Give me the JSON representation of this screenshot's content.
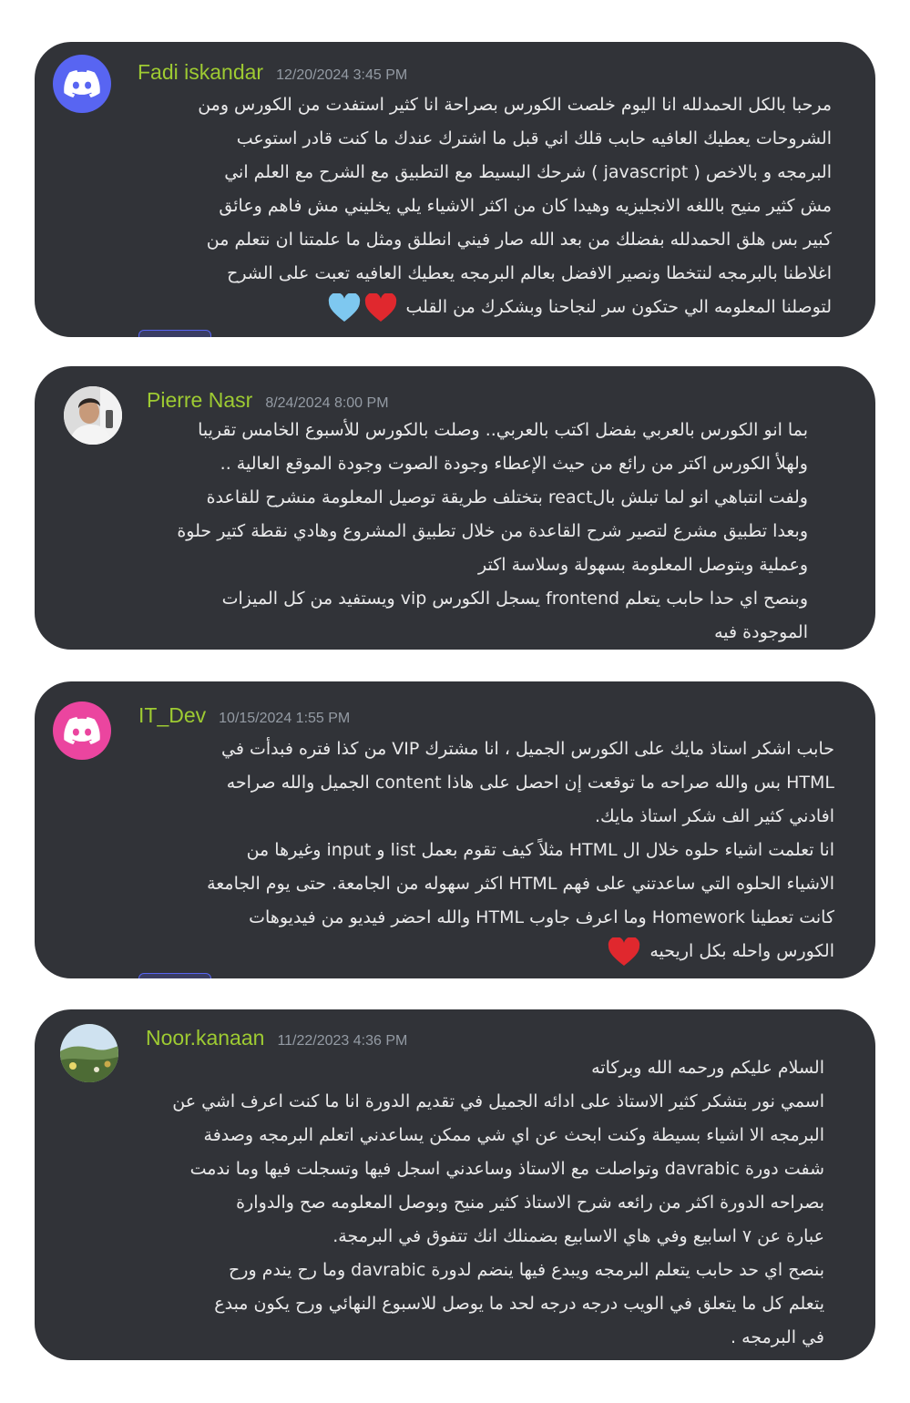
{
  "colors": {
    "card_bg": "#313338",
    "username": "#9ecb32",
    "timestamp": "#949ba4",
    "message_text": "#e9e9ea",
    "discord_blurple": "#5865f2",
    "discord_pink": "#eb459f",
    "heart_red": "#e0282e",
    "heart_blue": "#7ec8f0"
  },
  "messages": [
    {
      "username": "Fadi iskandar",
      "timestamp": "12/20/2024 3:45 PM",
      "avatar_icon": "discord-logo-icon",
      "lines": [
        "مرحبا بالكل الحمدلله انا اليوم خلصت الكورس بصراحة انا كثير استفدت من الكورس ومن",
        "الشروحات يعطيك العافيه حابب قلك اني قبل ما اشترك عندك ما كنت قادر استوعب",
        "البرمجه و بالاخص ( javascript ) شرحك البسيط مع التطبيق مع الشرح مع العلم اني",
        "مش كثير منيح باللغه الانجليزيه وهيدا كان من اكثر الاشياء يلي يخليني مش فاهم وعائق",
        "كبير بس هلق الحمدلله بفضلك من بعد الله صار فيني انطلق ومثل ما علمتنا ان نتعلم من",
        "اغلاطنا بالبرمجه لنتخطا ونصير الافضل بعالم البرمجه يعطيك العافيه تعبت على الشرح",
        "لتوصلنا المعلومه الي حتكون سر لنجاحنا وبشكرك من القلب"
      ],
      "emoji": [
        "red-heart-icon",
        "blue-heart-icon"
      ]
    },
    {
      "username": "Pierre Nasr",
      "timestamp": "8/24/2024 8:00 PM",
      "avatar_icon": "user-photo-avatar",
      "lines": [
        "بما انو الكورس بالعربي بفضل اكتب بالعربي.. وصلت بالكورس للأسبوع الخامس تقريبا",
        "ولهلأ الكورس اكتر من رائع من حيث الإعطاء وجودة الصوت وجودة الموقع العالية ..",
        "ولفت انتباهي انو لما تبلش بالreact بتختلف طريقة توصيل المعلومة منشرح للقاعدة",
        "وبعدا تطبيق مشرع لتصير شرح القاعدة من خلال تطبيق المشروع وهادي نقطة كتير حلوة",
        "وعملية وبتوصل المعلومة بسهولة وسلاسة اكتر",
        "وبنصح اي حدا حابب يتعلم frontend يسجل الكورس vip ويستفيد من كل الميزات",
        "الموجودة فيه"
      ],
      "emoji": []
    },
    {
      "username": "IT_Dev",
      "timestamp": "10/15/2024 1:55 PM",
      "avatar_icon": "discord-logo-icon",
      "lines": [
        "حابب اشكر استاذ مايك على الكورس الجميل ، انا مشترك VIP من كذا فتره فبدأت في",
        "HTML بس والله صراحه ما توقعت إن احصل على هاذا content الجميل والله صراحه",
        "افادني كثير الف شكر استاذ مايك.",
        "انا تعلمت اشياء حلوه خلال ال HTML مثلاً كيف تقوم بعمل list و input وغيرها من",
        "الاشياء الحلوه التي ساعدتني على فهم HTML اكثر سهوله من الجامعة. حتى يوم الجامعة",
        "كانت تعطينا Homework وما اعرف جاوب HTML والله احضر فيديو من فيديوهات",
        "الكورس واحله بكل اريحيه"
      ],
      "emoji": [
        "red-heart-icon"
      ]
    },
    {
      "username": "Noor.kanaan",
      "timestamp": "11/22/2023 4:36 PM",
      "avatar_icon": "landscape-photo-avatar",
      "lines": [
        "السلام عليكم ورحمه الله وبركاته",
        "اسمي نور بتشكر كثير الاستاذ على ادائه الجميل في تقديم الدورة انا ما كنت اعرف اشي عن",
        "البرمجه الا اشياء بسيطة وكنت ابحث عن اي شي ممكن يساعدني اتعلم البرمجه وصدفة",
        "شفت دورة davrabic وتواصلت مع الاستاذ وساعدني اسجل فيها وتسجلت فيها وما ندمت",
        "بصراحه الدورة اكثر من رائعه شرح الاستاذ كثير منيح وبوصل المعلومه صح والدوارة",
        "عبارة عن ٧ اسابيع وفي هاي الاسابيع بضمنلك انك تتفوق في البرمجة.",
        "بنصح اي حد حابب يتعلم البرمجه ويبدع فيها ينضم لدورة davrabic وما رح يندم ورح",
        "يتعلم كل ما يتعلق في الويب درجه درجه لحد ما يوصل للاسبوع النهائي ورح يكون مبدع",
        "في البرمجه ."
      ],
      "emoji": []
    }
  ]
}
